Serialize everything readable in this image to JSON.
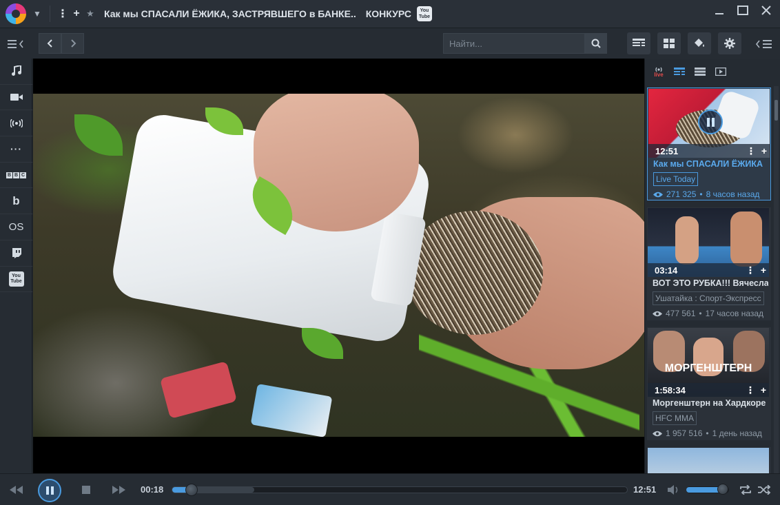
{
  "titlebar": {
    "title": "Как мы СПАСАЛИ ЁЖИКА, ЗАСТРЯВШЕГО в БАНКЕ..",
    "suffix": "КОНКУРС",
    "source_badge": "You Tube"
  },
  "toolbar": {
    "search_placeholder": "Найти..."
  },
  "sidebar": {
    "items": [
      {
        "icon": "music-icon"
      },
      {
        "icon": "video-camera-icon"
      },
      {
        "icon": "broadcast-icon"
      },
      {
        "icon": "more-icon",
        "label": "···"
      },
      {
        "icon": "bbc-icon",
        "label": [
          "B",
          "B",
          "C"
        ]
      },
      {
        "icon": "b-service-icon",
        "label": "b"
      },
      {
        "icon": "os-icon",
        "label": "OS"
      },
      {
        "icon": "twitch-icon"
      },
      {
        "icon": "youtube-icon",
        "label": "You Tube"
      }
    ]
  },
  "panel": {
    "live_tab": "live",
    "videos": [
      {
        "duration": "12:51",
        "title": "Как мы СПАСАЛИ ЁЖИКА",
        "channel": "Live Today",
        "views": "271 325",
        "age": "8 часов назад",
        "active": true
      },
      {
        "duration": "03:14",
        "title": "ВОТ ЭТО РУБКА!!! Вячеслав",
        "channel": "Ушатайка : Спорт-Экспресс",
        "views": "477 561",
        "age": "17 часов назад",
        "active": false
      },
      {
        "duration": "1:58:34",
        "title": "Моргенштерн на Хардкоре",
        "channel": "HFC MMA",
        "views": "1 957 516",
        "age": "1 день назад",
        "active": false,
        "thumb_text": "МОРГЕНШТЕРН"
      }
    ]
  },
  "controls": {
    "current_time": "00:18",
    "total_time": "12:51",
    "progress": 0.023,
    "buffered": 0.18,
    "volume": 0.85
  },
  "colors": {
    "accent": "#4a9be0",
    "background": "#20252b"
  }
}
